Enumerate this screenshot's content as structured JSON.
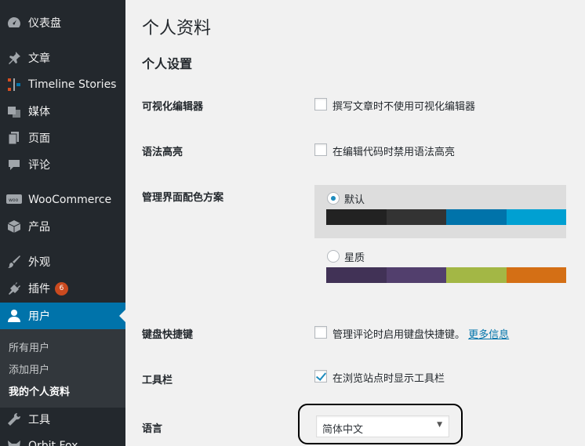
{
  "sidebar": {
    "items": [
      {
        "label": "仪表盘",
        "icon": "dashboard-icon"
      },
      {
        "label": "文章",
        "icon": "pin-icon"
      },
      {
        "label": "Timeline Stories",
        "icon": "timeline-icon"
      },
      {
        "label": "媒体",
        "icon": "media-icon"
      },
      {
        "label": "页面",
        "icon": "page-icon"
      },
      {
        "label": "评论",
        "icon": "comment-icon"
      },
      {
        "label": "WooCommerce",
        "icon": "woo-icon"
      },
      {
        "label": "产品",
        "icon": "box-icon"
      },
      {
        "label": "外观",
        "icon": "brush-icon"
      },
      {
        "label": "插件",
        "icon": "plugin-icon",
        "badge": "6"
      },
      {
        "label": "用户",
        "icon": "user-icon"
      },
      {
        "label": "工具",
        "icon": "wrench-icon"
      },
      {
        "label": "Orbit Fox",
        "icon": "fox-icon"
      }
    ],
    "submenu": [
      "所有用户",
      "添加用户",
      "我的个人资料"
    ]
  },
  "page": {
    "title": "个人资料",
    "section_title": "个人设置",
    "visual_editor": {
      "label": "可视化编辑器",
      "option": "撰写文章时不使用可视化编辑器",
      "checked": false
    },
    "syntax": {
      "label": "语法高亮",
      "option": "在编辑代码时禁用语法高亮",
      "checked": false
    },
    "color_scheme": {
      "label": "管理界面配色方案",
      "schemes": [
        {
          "name": "默认",
          "selected": true,
          "colors": [
            "#222222",
            "#333333",
            "#0073aa",
            "#00a0d2"
          ]
        },
        {
          "name": "星质",
          "selected": false,
          "colors": [
            "#413256",
            "#523f6d",
            "#a3b745",
            "#d46f15"
          ]
        }
      ]
    },
    "keyboard": {
      "label": "键盘快捷键",
      "option": "管理评论时启用键盘快捷键。",
      "link": "更多信息",
      "checked": false
    },
    "toolbar": {
      "label": "工具栏",
      "option": "在浏览站点时显示工具栏",
      "checked": true
    },
    "language": {
      "label": "语言",
      "value": "简体中文"
    }
  }
}
